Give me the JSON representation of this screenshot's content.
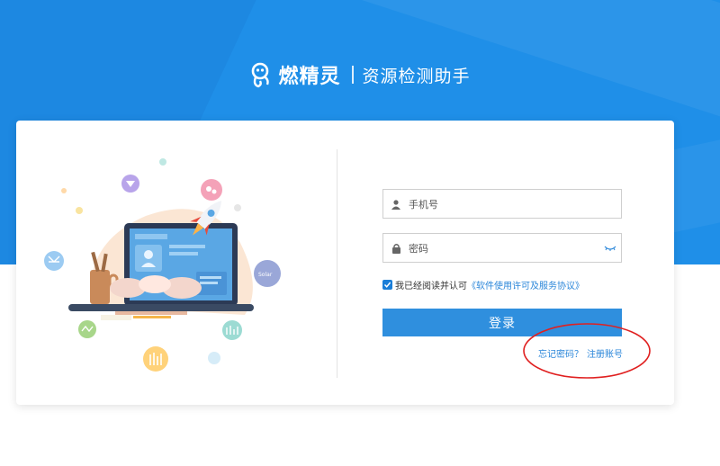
{
  "brand": {
    "name": "燃精灵",
    "subtitle": "资源检测助手"
  },
  "form": {
    "phone_placeholder": "手机号",
    "password_placeholder": "密码",
    "agree_text": "我已经阅读并认可",
    "agreement_link": "《软件使用许可及服务协议》",
    "agree_checked": true,
    "login_label": "登录",
    "forgot_label": "忘记密码？",
    "register_label": "注册账号"
  },
  "illustration": {
    "badge_text": "Solar"
  },
  "colors": {
    "banner": "#1f8fe8",
    "primary_button": "#2f8fde",
    "link": "#2a86d9",
    "annotation": "#e02020"
  }
}
